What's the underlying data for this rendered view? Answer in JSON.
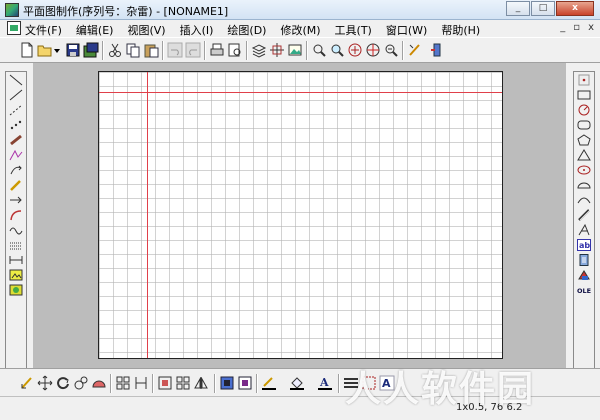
{
  "window": {
    "title": "平面图制作(序列号：杂雷) - [NONAME1]",
    "controls": [
      "_",
      "□",
      "x"
    ]
  },
  "menu": {
    "items": [
      "文件(F)",
      "编辑(E)",
      "视图(V)",
      "插入(I)",
      "绘图(D)",
      "修改(M)",
      "工具(T)",
      "窗口(W)",
      "帮助(H)"
    ],
    "mdi_controls": [
      "_",
      "▫",
      "x"
    ]
  },
  "toolbar": {
    "icons": [
      "new-icon",
      "open-icon",
      "dropdown-icon",
      "save-icon",
      "save-all-icon",
      "cut-icon",
      "copy-icon",
      "paste-icon",
      "undo-icon",
      "redo-icon",
      "print-icon",
      "print-preview-icon",
      "layers-icon",
      "group-icon",
      "image-icon",
      "zoom-realtime-icon",
      "zoom-window-icon",
      "zoom-extents-icon",
      "pan-icon",
      "zoom-reset-icon",
      "draw-icon",
      "export-icon"
    ]
  },
  "left_tools": [
    "line",
    "polyline",
    "dashed-line",
    "points",
    "ruler",
    "angle",
    "arc-arrow",
    "pencil",
    "arrow",
    "curve-arrow",
    "wave",
    "hatch",
    "dimension",
    "insert-image",
    "picture"
  ],
  "right_tools": [
    "dot",
    "rectangle",
    "circle",
    "rounded-rectangle",
    "pentagon",
    "triangle",
    "ellipse",
    "semi-ellipse",
    "arc",
    "wall",
    "text-style",
    "text-ab",
    "document",
    "paint",
    "ole"
  ],
  "right_labels": {
    "text_ab": "ab",
    "ole": "OLE"
  },
  "bottom_toolbar": {
    "icons": [
      "select-icon",
      "move-icon",
      "rotate-icon",
      "scale-icon",
      "fill-icon",
      "copy-objects-icon",
      "array-icon",
      "align-icon",
      "mirror-icon",
      "flip-icon",
      "front-icon",
      "back-icon",
      "line-color-icon",
      "fill-color-icon",
      "text-color-icon",
      "line-style-icon",
      "hatch-pattern-icon",
      "text-icon",
      "toggle-icon"
    ],
    "text_color_label": "A",
    "text_label": "A"
  },
  "status": {
    "coordinates": "1x0.5,  76 6.2"
  },
  "watermark": "人人软件园",
  "colors": {
    "guide": "#e0404a",
    "paper": "#ffffff",
    "canvas": "#bcbcbc"
  }
}
